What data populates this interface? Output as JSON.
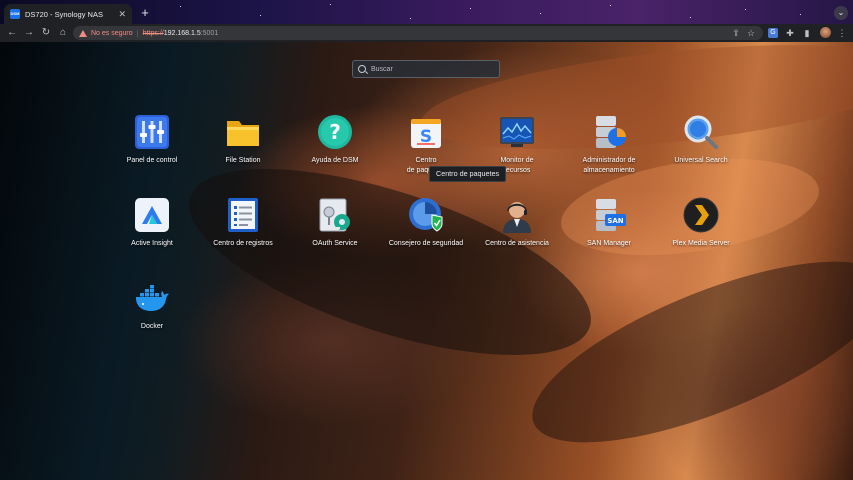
{
  "browser": {
    "tab_title": "DS720 - Synology NAS",
    "tab_favicon_text": "DSM",
    "new_tab_symbol": "+",
    "not_secure_label": "No es seguro",
    "url_scheme": "https://",
    "url_host": "192.168.1.5",
    "url_port": ":5001"
  },
  "search": {
    "placeholder": "Buscar"
  },
  "apps": {
    "panel_control": "Panel de control",
    "file_station": "File Station",
    "ayuda_dsm": "Ayuda de DSM",
    "centro_paquetes_line1": "Centro",
    "centro_paquetes_line2": "de paquetes",
    "monitor_line1": "Monitor de",
    "monitor_line2": "recursos",
    "admin_line1": "Administrador de",
    "admin_line2": "almacenamiento",
    "universal_search": "Universal Search",
    "active_insight": "Active Insight",
    "centro_registros": "Centro de registros",
    "oauth": "OAuth Service",
    "consejero": "Consejero de seguridad",
    "asistencia": "Centro de asistencia",
    "san_manager": "SAN Manager",
    "san_badge": "SAN",
    "plex": "Plex Media Server",
    "docker": "Docker"
  },
  "tooltip": "Centro de paquetes",
  "icons": {
    "back": "arrow-left-icon",
    "forward": "arrow-right-icon",
    "reload": "reload-icon",
    "home": "home-icon",
    "warning": "warning-icon",
    "share": "share-icon",
    "bookmark": "star-icon",
    "translate": "translate-icon",
    "extensions": "puzzle-icon",
    "sidebar": "sidebar-icon",
    "menu": "kebab-menu-icon"
  }
}
